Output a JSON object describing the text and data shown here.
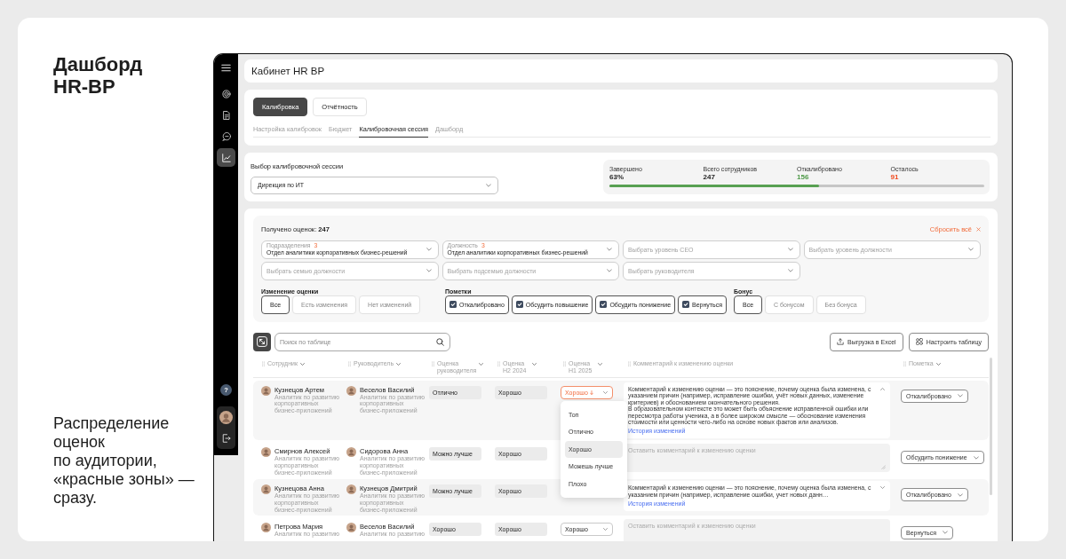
{
  "promo": {
    "title": "Дашборд HR-BP",
    "caption": "Распределение оценок по аудитории, «красные зоны» — сразу."
  },
  "sidebar": {
    "items": [
      {
        "selected": false
      },
      {
        "selected": false
      },
      {
        "selected": false
      },
      {
        "selected": true
      }
    ],
    "help": "?"
  },
  "header": {
    "title": "Кабинет HR BP"
  },
  "tabs": [
    {
      "label": "Калибровка",
      "selected": true
    },
    {
      "label": "Отчётность",
      "selected": false
    }
  ],
  "subtabs": [
    {
      "label": "Настройка калибровок",
      "selected": false
    },
    {
      "label": "Бюджет",
      "selected": false
    },
    {
      "label": "Калибровочная сессия",
      "selected": true
    },
    {
      "label": "Дашборд",
      "selected": false
    }
  ],
  "session": {
    "label": "Выбор калибровочной сессии",
    "value": "Дирекция по ИТ"
  },
  "stats": {
    "items": [
      {
        "label": "Завершено",
        "value": "63%"
      },
      {
        "label": "Всего сотрудников",
        "value": "247"
      },
      {
        "label": "Откалибровано",
        "value": "156",
        "color": "#4f9a49"
      },
      {
        "label": "Осталось",
        "value": "91",
        "color": "#f04a1e"
      }
    ],
    "level": 0.56
  },
  "filters": {
    "summary": "Получено оценок: **247**",
    "reset": "Сбросить всё",
    "selects": [
      {
        "label": "Подразделения",
        "count": "3",
        "value": "Отдел аналитики корпоративных бизнес-решений"
      },
      {
        "label": "Должность",
        "count": "3",
        "value": "Отдел аналитики корпоративных бизнес-решений"
      },
      {
        "placeholder": "Выбрать уровень CEO"
      },
      {
        "placeholder": "Выбрать уровень должности"
      },
      {
        "placeholder": "Выбрать семью должности"
      },
      {
        "placeholder": "Выбрать подсемью должности"
      },
      {
        "placeholder": "Выбрать руководителя"
      }
    ],
    "groups": [
      {
        "title": "Изменение оценки",
        "kind": "segment",
        "options": [
          {
            "label": "Все",
            "selected": true
          },
          {
            "label": "Есть изменения",
            "selected": false
          },
          {
            "label": "Нет изменений",
            "selected": false
          }
        ]
      },
      {
        "title": "Пометки",
        "kind": "checks",
        "options": [
          {
            "label": "Откалибровано",
            "checked": true
          },
          {
            "label": "Обсудить повышение",
            "checked": true
          },
          {
            "label": "Обсудить понижение",
            "checked": true
          },
          {
            "label": "Вернуться",
            "checked": true
          }
        ]
      },
      {
        "title": "Бонус",
        "kind": "segment",
        "options": [
          {
            "label": "Все",
            "selected": true
          },
          {
            "label": "С бонусом",
            "selected": false
          },
          {
            "label": "Без бонуса",
            "selected": false
          }
        ]
      }
    ]
  },
  "toolbar": {
    "search_placeholder": "Поиск по таблице",
    "buttons": [
      {
        "label": "Выгрузка в Excel",
        "kind": "upload"
      },
      {
        "label": "Настроить таблицу",
        "kind": "columns"
      }
    ]
  },
  "table": {
    "columns": [
      {
        "label": "Сотрудник",
        "dropdown": true
      },
      {
        "label": "Руководитель",
        "dropdown": true
      },
      {
        "label": "Оценка руководителя",
        "dropdown": true
      },
      {
        "label": "Оценка H2 2024",
        "dropdown": true
      },
      {
        "label": "Оценка H1 2025",
        "dropdown": true
      },
      {
        "label": "Комментарий к изменению оценки",
        "dropdown": false
      },
      {
        "label": "Пометка",
        "dropdown": true
      }
    ],
    "rows": [
      {
        "employee": {
          "name": "Кузнецов Артем",
          "role": "Аналитик по развитию корпоративных бизнес-приложений"
        },
        "manager": {
          "name": "Веселов Василий",
          "role": "Аналитик по развитию корпоративных бизнес-приложений"
        },
        "manager_rating": "Отлично",
        "h2_2024": "Хорошо",
        "h1_2025": {
          "value": "Хорошо",
          "changed": true,
          "expanded": true,
          "options": [
            {
              "label": "Топ",
              "selected": false
            },
            {
              "label": "Отлично",
              "selected": false
            },
            {
              "label": "Хорошо",
              "selected": true
            },
            {
              "label": "Можешь лучше",
              "selected": false
            },
            {
              "label": "Плохо",
              "selected": false
            }
          ]
        },
        "comment": {
          "kind": "text",
          "text": "Комментарий к изменению оценки — это пояснение, почему оценка была изменена, с указанием причин (например, исправление ошибки, учёт новых данных, изменение критериев) и обоснованием окончательного решения.\nВ образовательном контексте это может быть объяснение исправленной ошибки или пересмотра работы ученика, а в более широком смысле — обоснование изменения стоимости или ценности чего-либо на основе новых фактов или анализов.",
          "expanded": true,
          "link": "История изменений"
        },
        "mark": "Откалибровано"
      },
      {
        "employee": {
          "name": "Смирнов Алексей",
          "role": "Аналитик по развитию корпоративных бизнес-приложений"
        },
        "manager": {
          "name": "Сидорова Анна",
          "role": "Аналитик по развитию корпоративных бизнес-приложений"
        },
        "manager_rating": "Можно лучше",
        "h2_2024": "Хорошо",
        "comment": {
          "kind": "input",
          "placeholder": "Оставить комментарий к изменению оценки",
          "resizable": true
        },
        "mark": "Обсудить понижение"
      },
      {
        "employee": {
          "name": "Кузнецова Анна",
          "role": "Аналитик по развитию корпоративных бизнес-приложений"
        },
        "manager": {
          "name": "Кузнецов Дмитрий",
          "role": "Аналитик по развитию корпоративных бизнес-приложений"
        },
        "manager_rating": "Можно лучше",
        "h2_2024": "Хорошо",
        "comment": {
          "kind": "text",
          "text": "Комментарий к изменению оценки — это пояснение, почему оценка была изменена, с указанием причин (например, исправление ошибки, учет новых данн…",
          "expanded": false,
          "link": "История изменений"
        },
        "mark": "Откалибровано"
      },
      {
        "employee": {
          "name": "Петрова Мария",
          "role": "Аналитик по развитию"
        },
        "manager": {
          "name": "Веселов Василий",
          "role": "Аналитик по развитию"
        },
        "manager_rating": "Хорошо",
        "h2_2024": "Хорошо",
        "h1_2025": {
          "value": "Хорошо",
          "changed": false
        },
        "comment": {
          "kind": "input",
          "placeholder": "Оставить комментарий к изменению оценки"
        },
        "mark": "Вернуться"
      }
    ]
  }
}
